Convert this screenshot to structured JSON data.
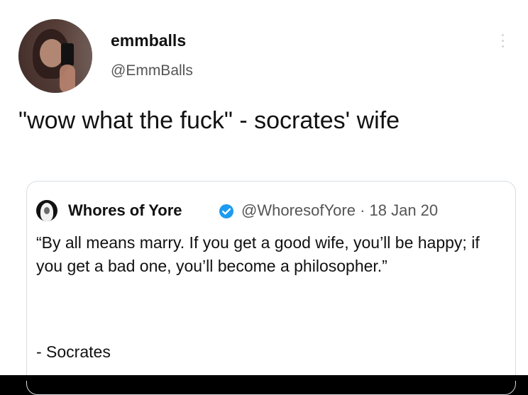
{
  "tweet": {
    "display_name": "emmballs",
    "handle": "@EmmBalls",
    "text": "\"wow what the fuck\" - socrates' wife"
  },
  "quote": {
    "name": "Whores of Yore",
    "handle": "@WhoresofYore",
    "separator": "·",
    "date": "18 Jan 20",
    "body": "“By all means marry. If you get a good wife, you’ll be happy; if you get a bad one, you’ll become a philosopher.”",
    "signature": "- Socrates",
    "verified": true
  },
  "icons": {
    "more": "more-vertical-icon",
    "verified": "verified-badge-icon"
  },
  "colors": {
    "verified_blue": "#1d9bf0",
    "text": "#111111",
    "muted": "#555555",
    "border": "#d9dee2"
  }
}
